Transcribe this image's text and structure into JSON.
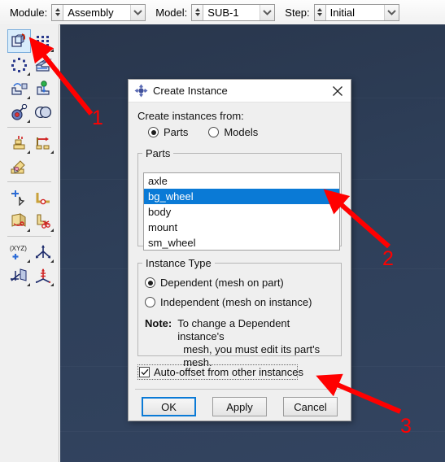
{
  "context_bar": {
    "module": {
      "label": "Module:",
      "value": "Assembly",
      "icon": "spinner-icon"
    },
    "model": {
      "label": "Model:",
      "value": "SUB-1",
      "icon": "spinner-icon"
    },
    "step": {
      "label": "Step:",
      "value": "Initial",
      "icon": "spinner-icon"
    }
  },
  "toolbar": {
    "name": "assembly-module-toolbar",
    "groups": [
      {
        "items": [
          {
            "icon": "create-instance-icon",
            "selected": true
          },
          {
            "icon": "linear-pattern-icon",
            "selected": false
          },
          {
            "icon": "radial-pattern-icon",
            "selected": false
          },
          {
            "icon": "translate-instance-icon",
            "selected": false
          },
          {
            "icon": "rotate-instance-icon",
            "selected": false
          },
          {
            "icon": "translate-to-icon",
            "selected": false
          },
          {
            "icon": "position-constraint-icon",
            "selected": false
          },
          {
            "icon": "merge-cut-instances-icon",
            "selected": false
          }
        ]
      },
      {
        "items": [
          {
            "icon": "create-constraint-icon",
            "selected": false
          },
          {
            "icon": "convert-constraint-icon",
            "selected": false
          },
          {
            "icon": "edit-feature-icon",
            "selected": false
          }
        ]
      },
      {
        "items": [
          {
            "icon": "create-datum-point-icon",
            "selected": false
          },
          {
            "icon": "create-datum-axis-icon",
            "selected": false
          },
          {
            "icon": "create-partition-icon",
            "selected": false
          },
          {
            "icon": "cut-partition-icon",
            "selected": false
          }
        ]
      },
      {
        "items": [
          {
            "icon": "datum-point-xyz-icon",
            "selected": false
          },
          {
            "icon": "datum-axis-icon",
            "selected": false
          },
          {
            "icon": "datum-plane-icon",
            "selected": false
          },
          {
            "icon": "datum-csys-icon",
            "selected": false
          }
        ]
      }
    ]
  },
  "dialog": {
    "title": "Create Instance",
    "title_icon": "abaqus-diamond-icon",
    "close_icon": "close-icon",
    "create_from_label": "Create instances from:",
    "source_options": [
      {
        "label": "Parts",
        "selected": true
      },
      {
        "label": "Models",
        "selected": false
      }
    ],
    "parts_group": {
      "legend": "Parts",
      "items": [
        {
          "name": "axle",
          "selected": false
        },
        {
          "name": "bg_wheel",
          "selected": true
        },
        {
          "name": "body",
          "selected": false
        },
        {
          "name": "mount",
          "selected": false
        },
        {
          "name": "sm_wheel",
          "selected": false
        }
      ]
    },
    "instance_type_group": {
      "legend": "Instance Type",
      "options": [
        {
          "label": "Dependent (mesh on part)",
          "selected": true
        },
        {
          "label": "Independent (mesh on instance)",
          "selected": false
        }
      ],
      "note_label": "Note:",
      "note_line1": "To change a Dependent instance's",
      "note_line2": "mesh, you must edit its part's mesh."
    },
    "auto_offset": {
      "label": "Auto-offset from other instances",
      "checked": true,
      "check_icon": "checkmark-icon"
    },
    "buttons": [
      {
        "label": "OK",
        "default": true
      },
      {
        "label": "Apply",
        "default": false
      },
      {
        "label": "Cancel",
        "default": false
      }
    ]
  },
  "annotations": {
    "color": "#ff0000",
    "markers": [
      {
        "number": "1",
        "target": "create-instance-toolbar-button"
      },
      {
        "number": "2",
        "target": "parts-list-selected-item"
      },
      {
        "number": "3",
        "target": "auto-offset-checkbox"
      }
    ]
  },
  "colors": {
    "viewport_bg": "#2e3f59",
    "selection_blue": "#0a7ad6",
    "toolbar_bg": "#f0f0f0",
    "dialog_bg": "#efefef",
    "annotation_red": "#ff0000"
  }
}
